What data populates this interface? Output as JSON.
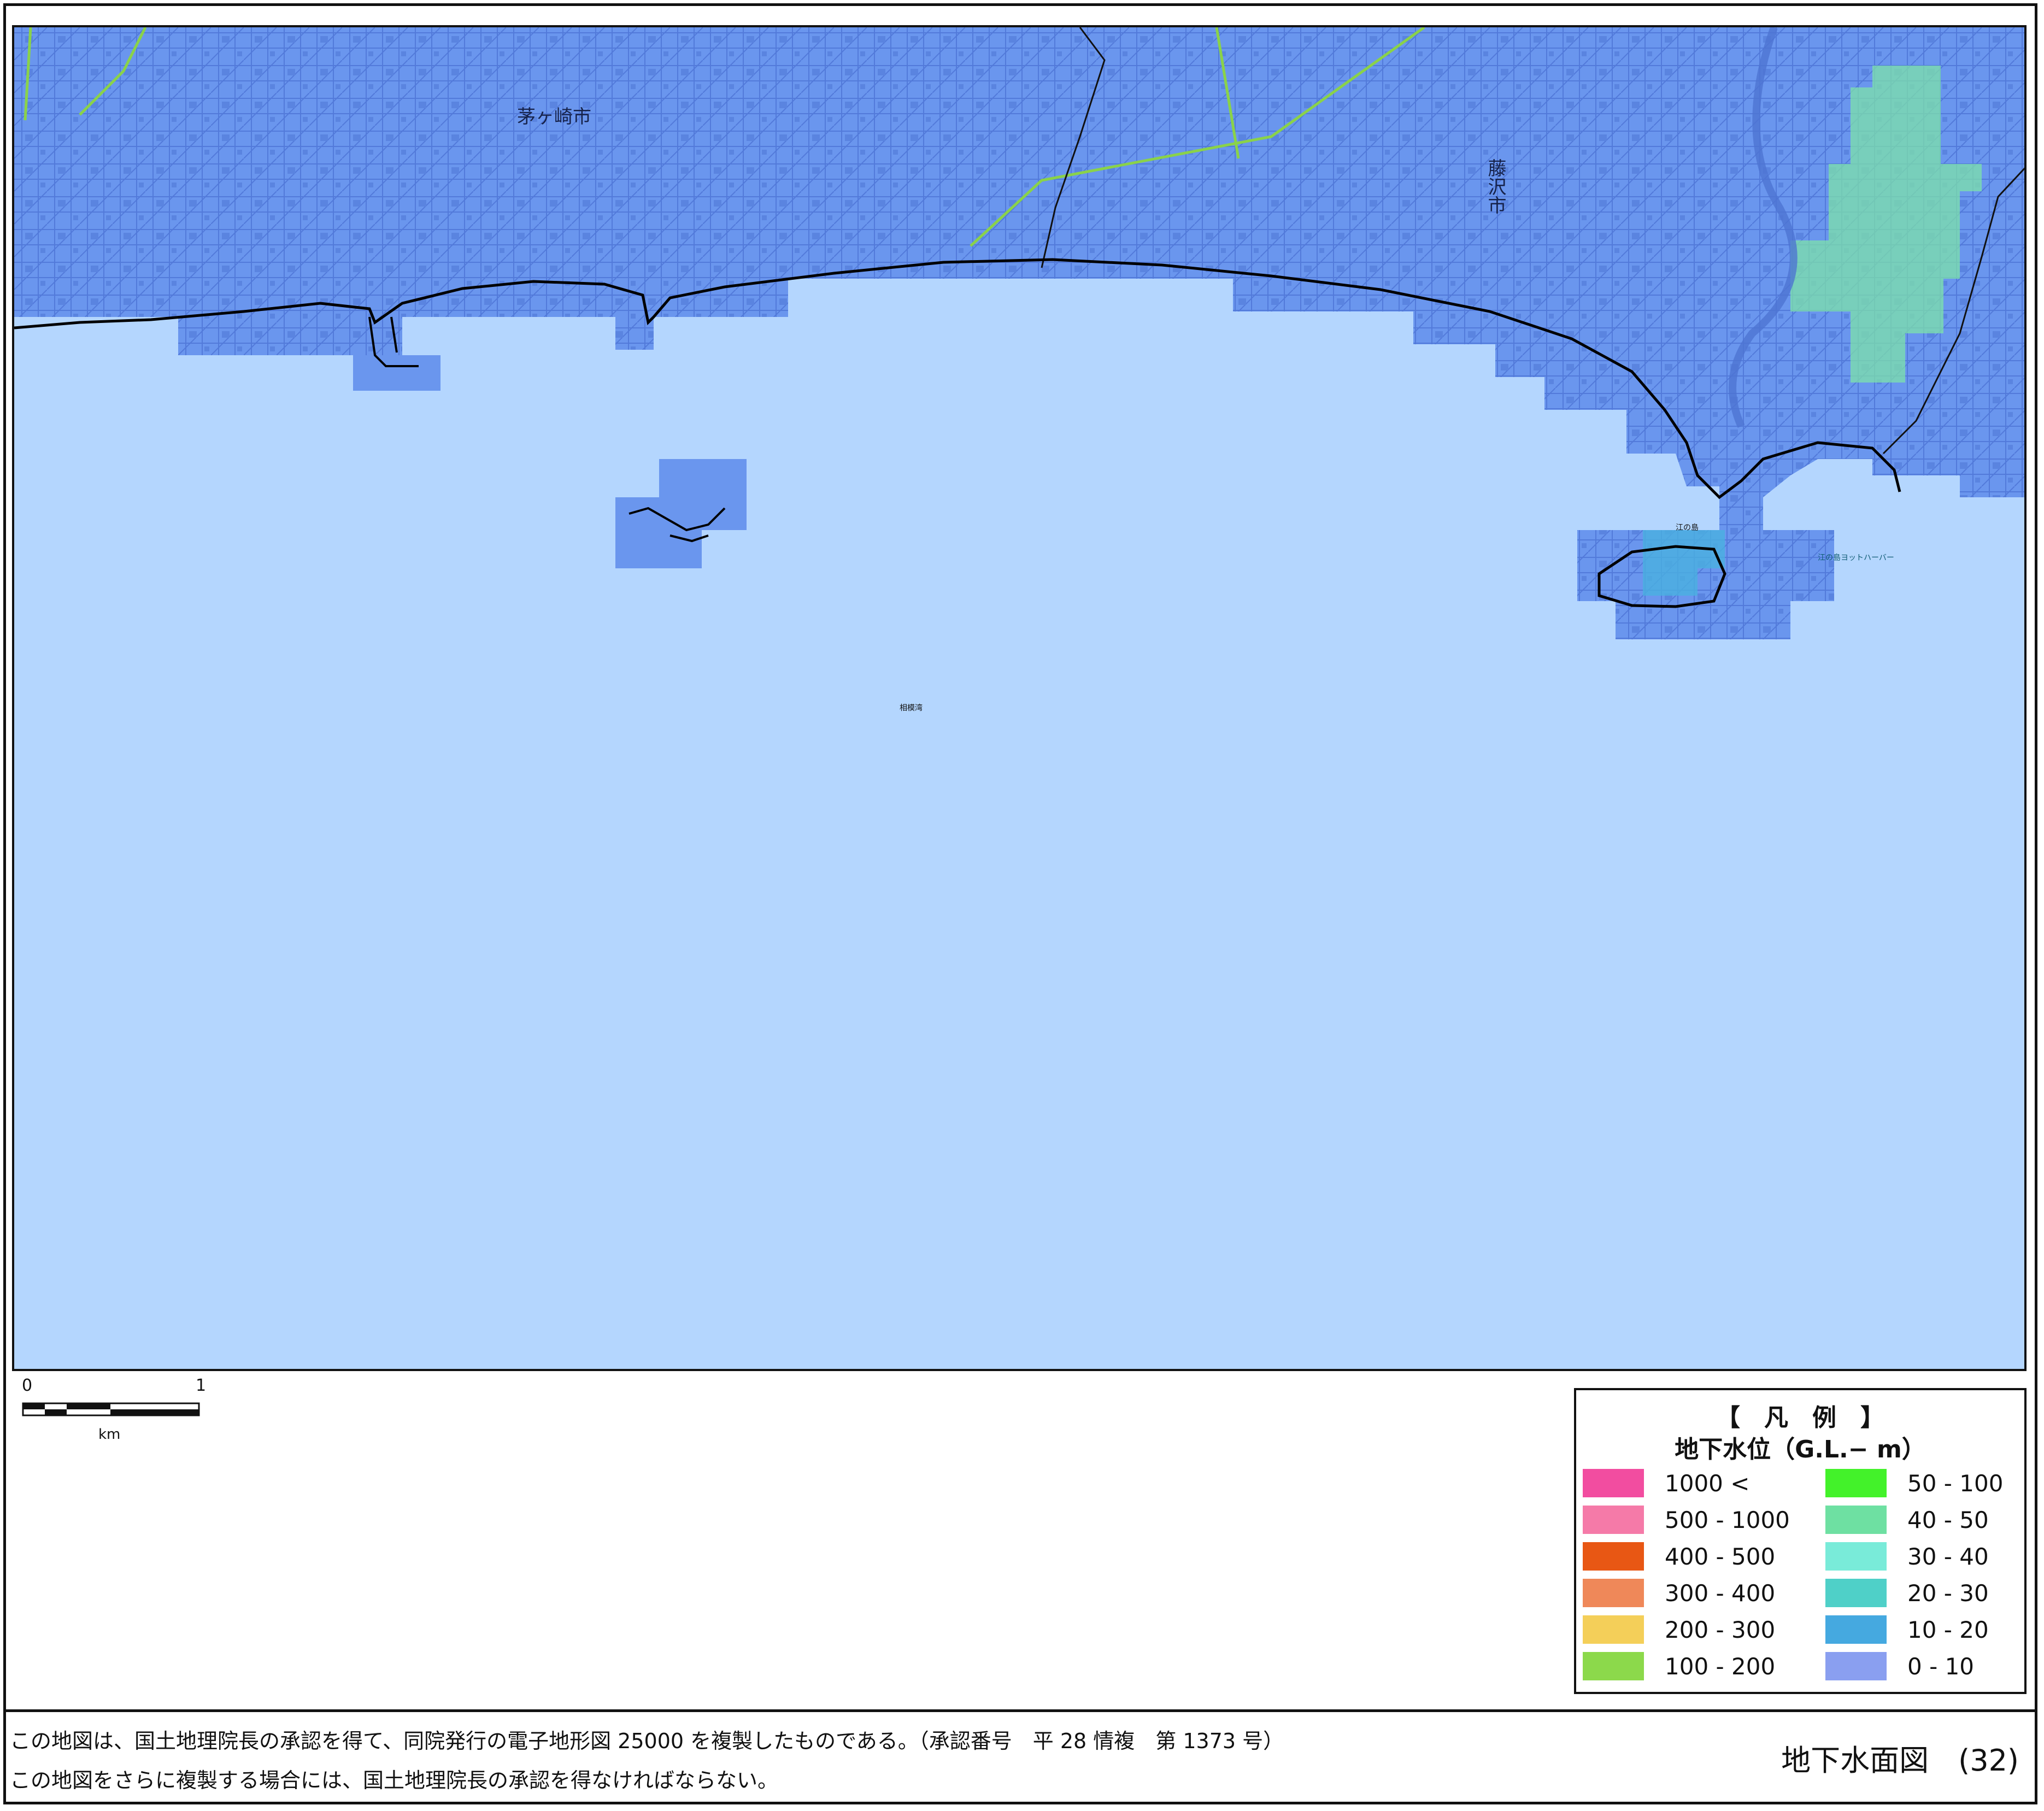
{
  "map": {
    "place_labels": [
      {
        "id": "chigasaki",
        "text": "茅ヶ崎市"
      },
      {
        "id": "fujisawa",
        "text": "藤沢市"
      },
      {
        "id": "enoshima",
        "text": "江の島"
      },
      {
        "id": "yacht_harbor",
        "text": "江の島ヨットハーバー"
      },
      {
        "id": "sagami_bay",
        "text": "相模湾"
      }
    ],
    "colors": {
      "sea": "#b4d6fe",
      "land_0_10": "#6a96ee",
      "land_10_20": "#4ab0e0",
      "land_40_50": "#7ee4a8",
      "coastline": "#000000",
      "roads": "#2a4eb8",
      "railway": "#8ad24a"
    }
  },
  "scale": {
    "zero": "0",
    "one": "1",
    "unit": "km"
  },
  "legend": {
    "title": "【　凡　例　】",
    "subtitle": "地下水位（G.L.− m）",
    "items": [
      {
        "label": "1000 <",
        "color": "#f24da0"
      },
      {
        "label": "500 - 1000",
        "color": "#f57aa8"
      },
      {
        "label": "400 - 500",
        "color": "#e85714"
      },
      {
        "label": "300 - 400",
        "color": "#ef8859"
      },
      {
        "label": "200 - 300",
        "color": "#f4cf59"
      },
      {
        "label": "100 - 200",
        "color": "#8cd94b"
      },
      {
        "label": "50 - 100",
        "color": "#43f22a"
      },
      {
        "label": "40 - 50",
        "color": "#6ee0a2"
      },
      {
        "label": "30 - 40",
        "color": "#79ebd9"
      },
      {
        "label": "20 - 30",
        "color": "#4fd0c8"
      },
      {
        "label": "10 - 20",
        "color": "#45a9e0"
      },
      {
        "label": "0 - 10",
        "color": "#8a9ff0"
      }
    ]
  },
  "footer": {
    "line1": "この地図は、国土地理院長の承認を得て、同院発行の電子地形図 25000 を複製したものである。（承認番号　平 28 情複　第 1373 号）",
    "line2": "この地図をさらに複製する場合には、国土地理院長の承認を得なければならない。",
    "title": "地下水面図　(32)"
  }
}
